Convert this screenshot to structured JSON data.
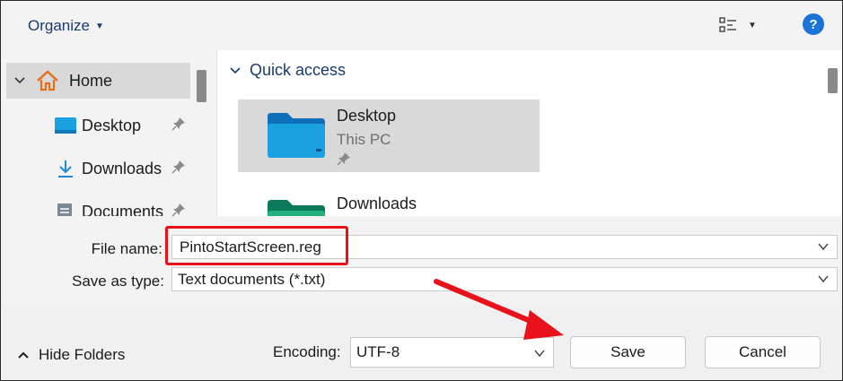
{
  "toolbar": {
    "organize_label": "Organize",
    "help_label": "?"
  },
  "nav": {
    "items": [
      {
        "label": "Home",
        "icon": "home-icon"
      },
      {
        "label": "Desktop",
        "icon": "desktop-icon"
      },
      {
        "label": "Downloads",
        "icon": "download-icon"
      },
      {
        "label": "Documents",
        "icon": "documents-icon"
      }
    ]
  },
  "main": {
    "section_title": "Quick access",
    "tiles": [
      {
        "title": "Desktop",
        "subtitle": "This PC"
      },
      {
        "title": "Downloads"
      }
    ]
  },
  "form": {
    "file_name_label": "File name:",
    "file_name_value": "PintoStartScreen.reg",
    "save_type_label": "Save as type:",
    "save_type_value": "Text documents (*.txt)"
  },
  "footer": {
    "hide_folders_label": "Hide Folders",
    "encoding_label": "Encoding:",
    "encoding_value": "UTF-8",
    "save_label": "Save",
    "cancel_label": "Cancel"
  },
  "colors": {
    "accent": "#1a3b6e",
    "highlight": "#e8121b",
    "folder_blue": "#1ba1e2"
  }
}
